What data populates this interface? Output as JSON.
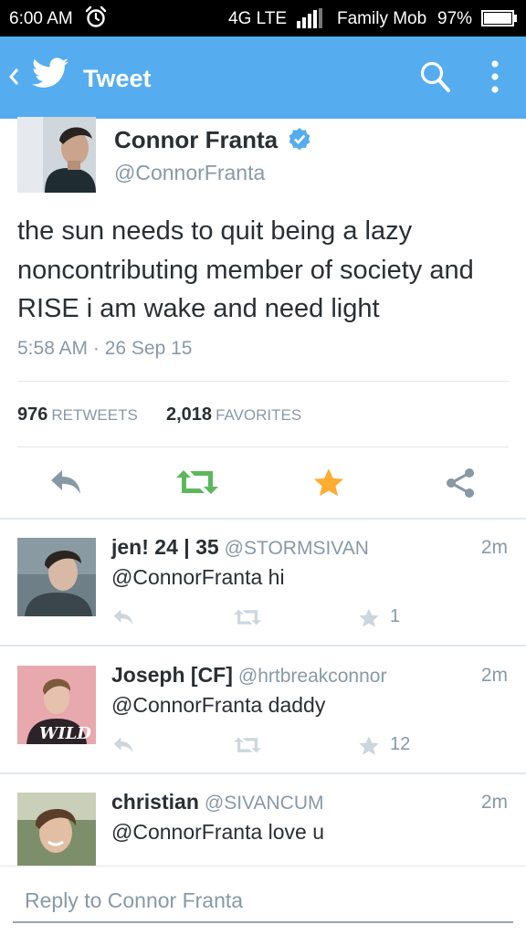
{
  "status_bar": {
    "time": "6:00 AM",
    "network": "4G LTE",
    "carrier": "Family Mob",
    "battery": "97%"
  },
  "app_bar": {
    "title": "Tweet",
    "accent_color": "#55acee"
  },
  "tweet": {
    "author_name": "Connor Franta",
    "author_handle": "@ConnorFranta",
    "text": "the sun needs to quit being a lazy noncontributing member of society and RISE i am wake and need light",
    "meta": "5:58 AM · 26 Sep 15",
    "retweets_count": "976",
    "retweets_label": "RETWEETS",
    "favorites_count": "2,018",
    "favorites_label": "FAVORITES",
    "actions": [
      "reply-icon",
      "retweet-icon",
      "favorite-icon",
      "share-icon"
    ]
  },
  "replies": [
    {
      "name": "jen! 24 | 35",
      "handle": "@STORMSIVAN",
      "time": "2m",
      "text": "@ConnorFranta hi",
      "favorites": "1"
    },
    {
      "name": "Joseph [CF]",
      "handle": "@hrtbreakconnor",
      "time": "2m",
      "text": "@ConnorFranta daddy",
      "favorites": "12",
      "avatar_shirt_text": "WILD"
    },
    {
      "name": "christian",
      "handle": "@SIVANCUM",
      "time": "2m",
      "text": "@ConnorFranta love u"
    }
  ],
  "composer": {
    "placeholder": "Reply to Connor Franta"
  }
}
